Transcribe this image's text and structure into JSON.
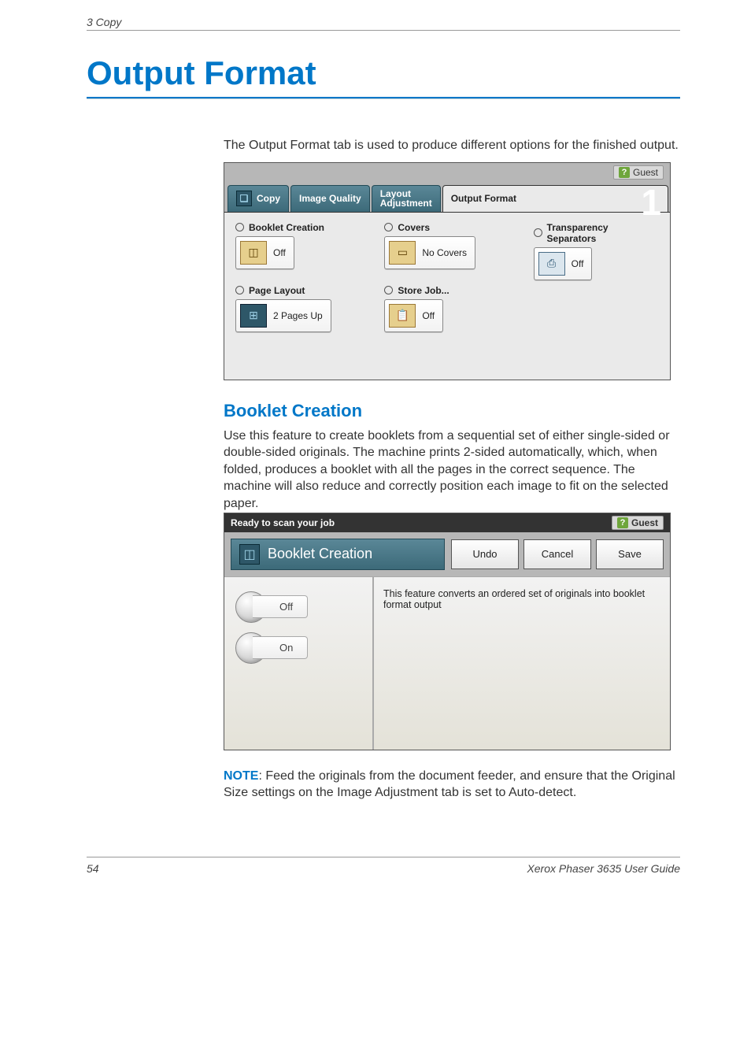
{
  "running_header": "3   Copy",
  "page_title": "Output Format",
  "intro_text": "The Output Format tab is used to produce different options for the finished output.",
  "panel1": {
    "guest_label": "Guest",
    "big_number": "1",
    "tabs": {
      "copy": "Copy",
      "image_quality": "Image Quality",
      "layout_line1": "Layout",
      "layout_line2": "Adjustment",
      "output_format": "Output Format"
    },
    "groups": {
      "booklet_creation": {
        "label": "Booklet Creation",
        "value": "Off"
      },
      "covers": {
        "label": "Covers",
        "value": "No Covers"
      },
      "transparency": {
        "label": "Transparency Separators",
        "value": "Off",
        "icon": "⎙"
      },
      "page_layout": {
        "label": "Page Layout",
        "value": "2 Pages Up",
        "icon": "⊞"
      },
      "store_job": {
        "label": "Store Job...",
        "value": "Off",
        "icon": "📋"
      }
    }
  },
  "section_heading": "Booklet Creation",
  "section_body": "Use this feature to create booklets from a sequential set of either single-sided or double-sided originals. The machine prints 2-sided automatically, which, when folded, produces a booklet with all the pages in the correct sequence. The machine will also reduce and correctly position each image to fit on the selected paper.",
  "panel2": {
    "status": "Ready to scan your job",
    "guest_label": "Guest",
    "dialog_title": "Booklet Creation",
    "buttons": {
      "undo": "Undo",
      "cancel": "Cancel",
      "save": "Save"
    },
    "toggles": {
      "off": "Off",
      "on": "On"
    },
    "description": "This feature converts an ordered set of originals into booklet format output"
  },
  "note_label": "NOTE",
  "note_body": ": Feed the originals from the document feeder, and ensure that the Original Size settings on the Image Adjustment tab is set to Auto-detect.",
  "footer": {
    "page_number": "54",
    "book_title": "Xerox Phaser 3635 User Guide"
  }
}
